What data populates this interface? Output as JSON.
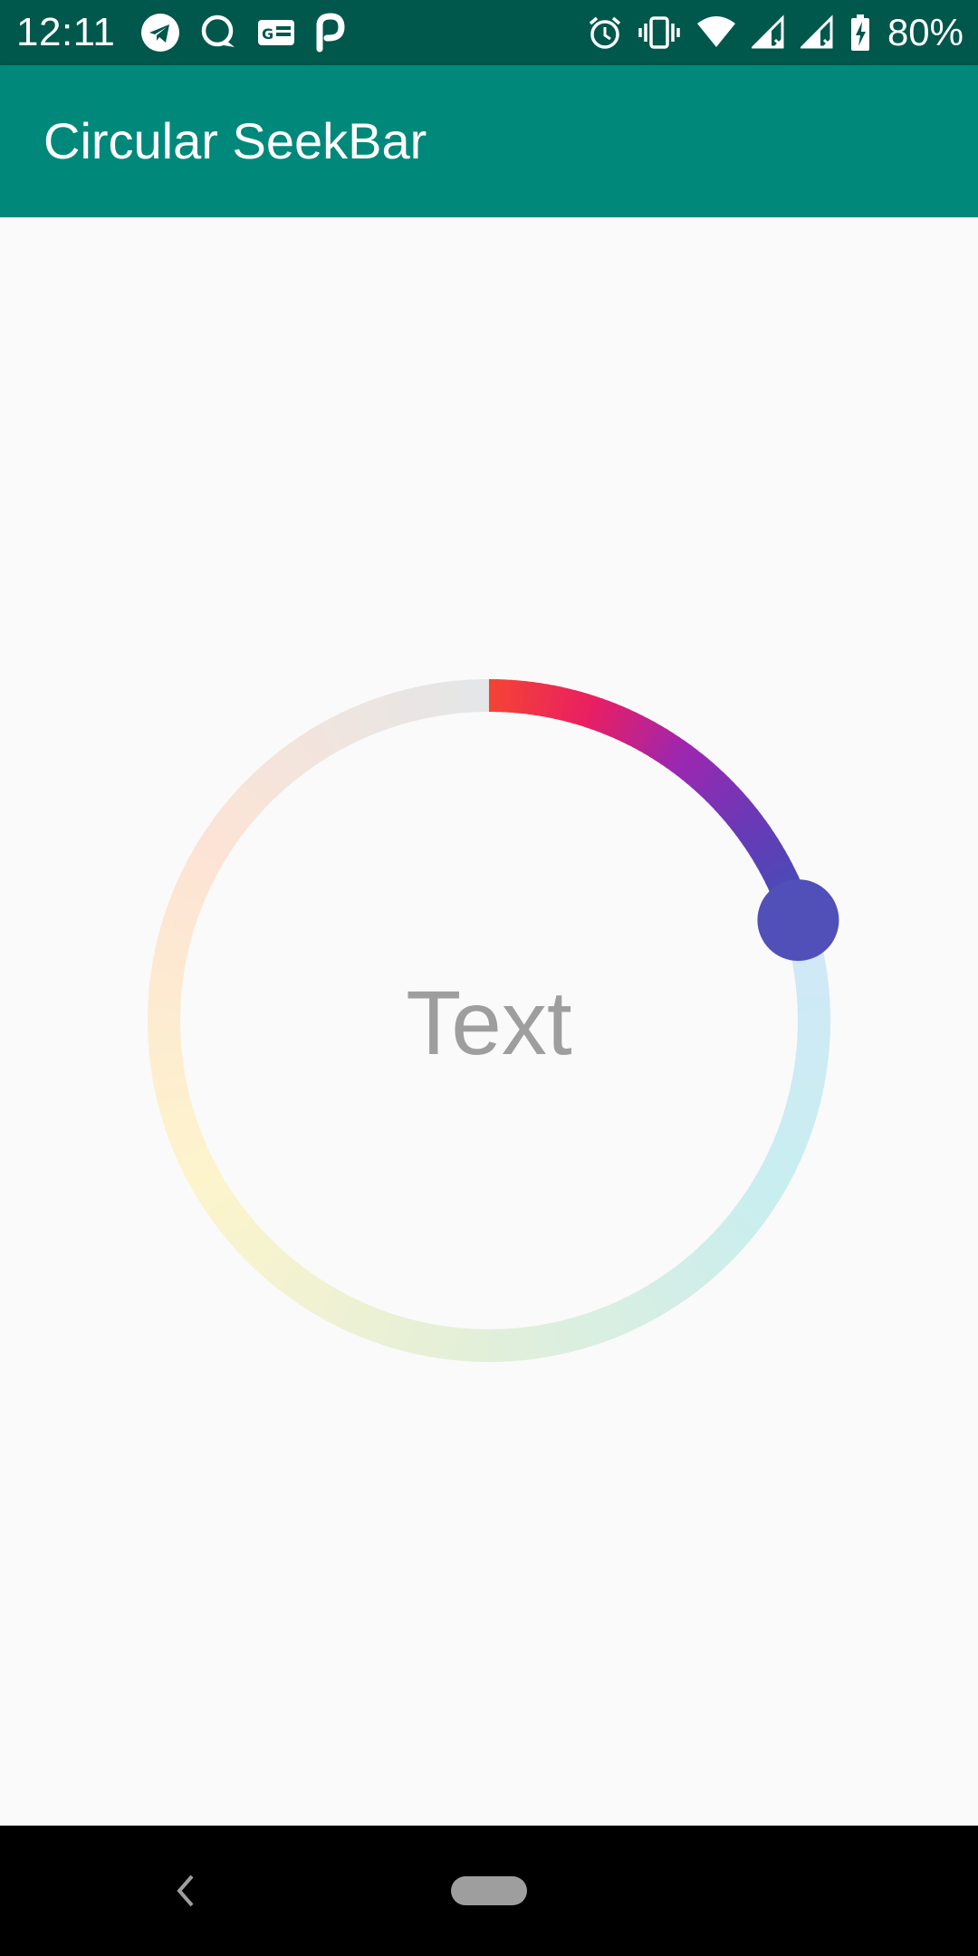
{
  "status_bar": {
    "time": "12:11",
    "battery": "80%",
    "left_icons": [
      "telegram-icon",
      "chat-bubble-icon",
      "news-icon",
      "p-app-icon"
    ],
    "right_icons": [
      "alarm-icon",
      "vibrate-icon",
      "wifi-icon",
      "signal-icon",
      "signal-icon",
      "battery-charging-icon"
    ],
    "color": "#00574b"
  },
  "app_bar": {
    "title": "Circular SeekBar",
    "color": "#00897b"
  },
  "seekbar": {
    "center_text": "Text",
    "progress_fraction": 0.2,
    "progress_gradient": [
      "#f44336",
      "#e91e63",
      "#9c27b0",
      "#673ab7",
      "#3f51b5"
    ],
    "track_gradient": [
      "#e3e6e8",
      "#fde3d5",
      "#fdf4cc",
      "#e2efd9",
      "#c8eef0",
      "#d3e6fa",
      "#d9dee8"
    ],
    "thumb_color": "#5050b8",
    "text_color": "#9e9e9e"
  },
  "nav_bar": {
    "icons": [
      "back-icon",
      "home-pill-icon"
    ]
  }
}
